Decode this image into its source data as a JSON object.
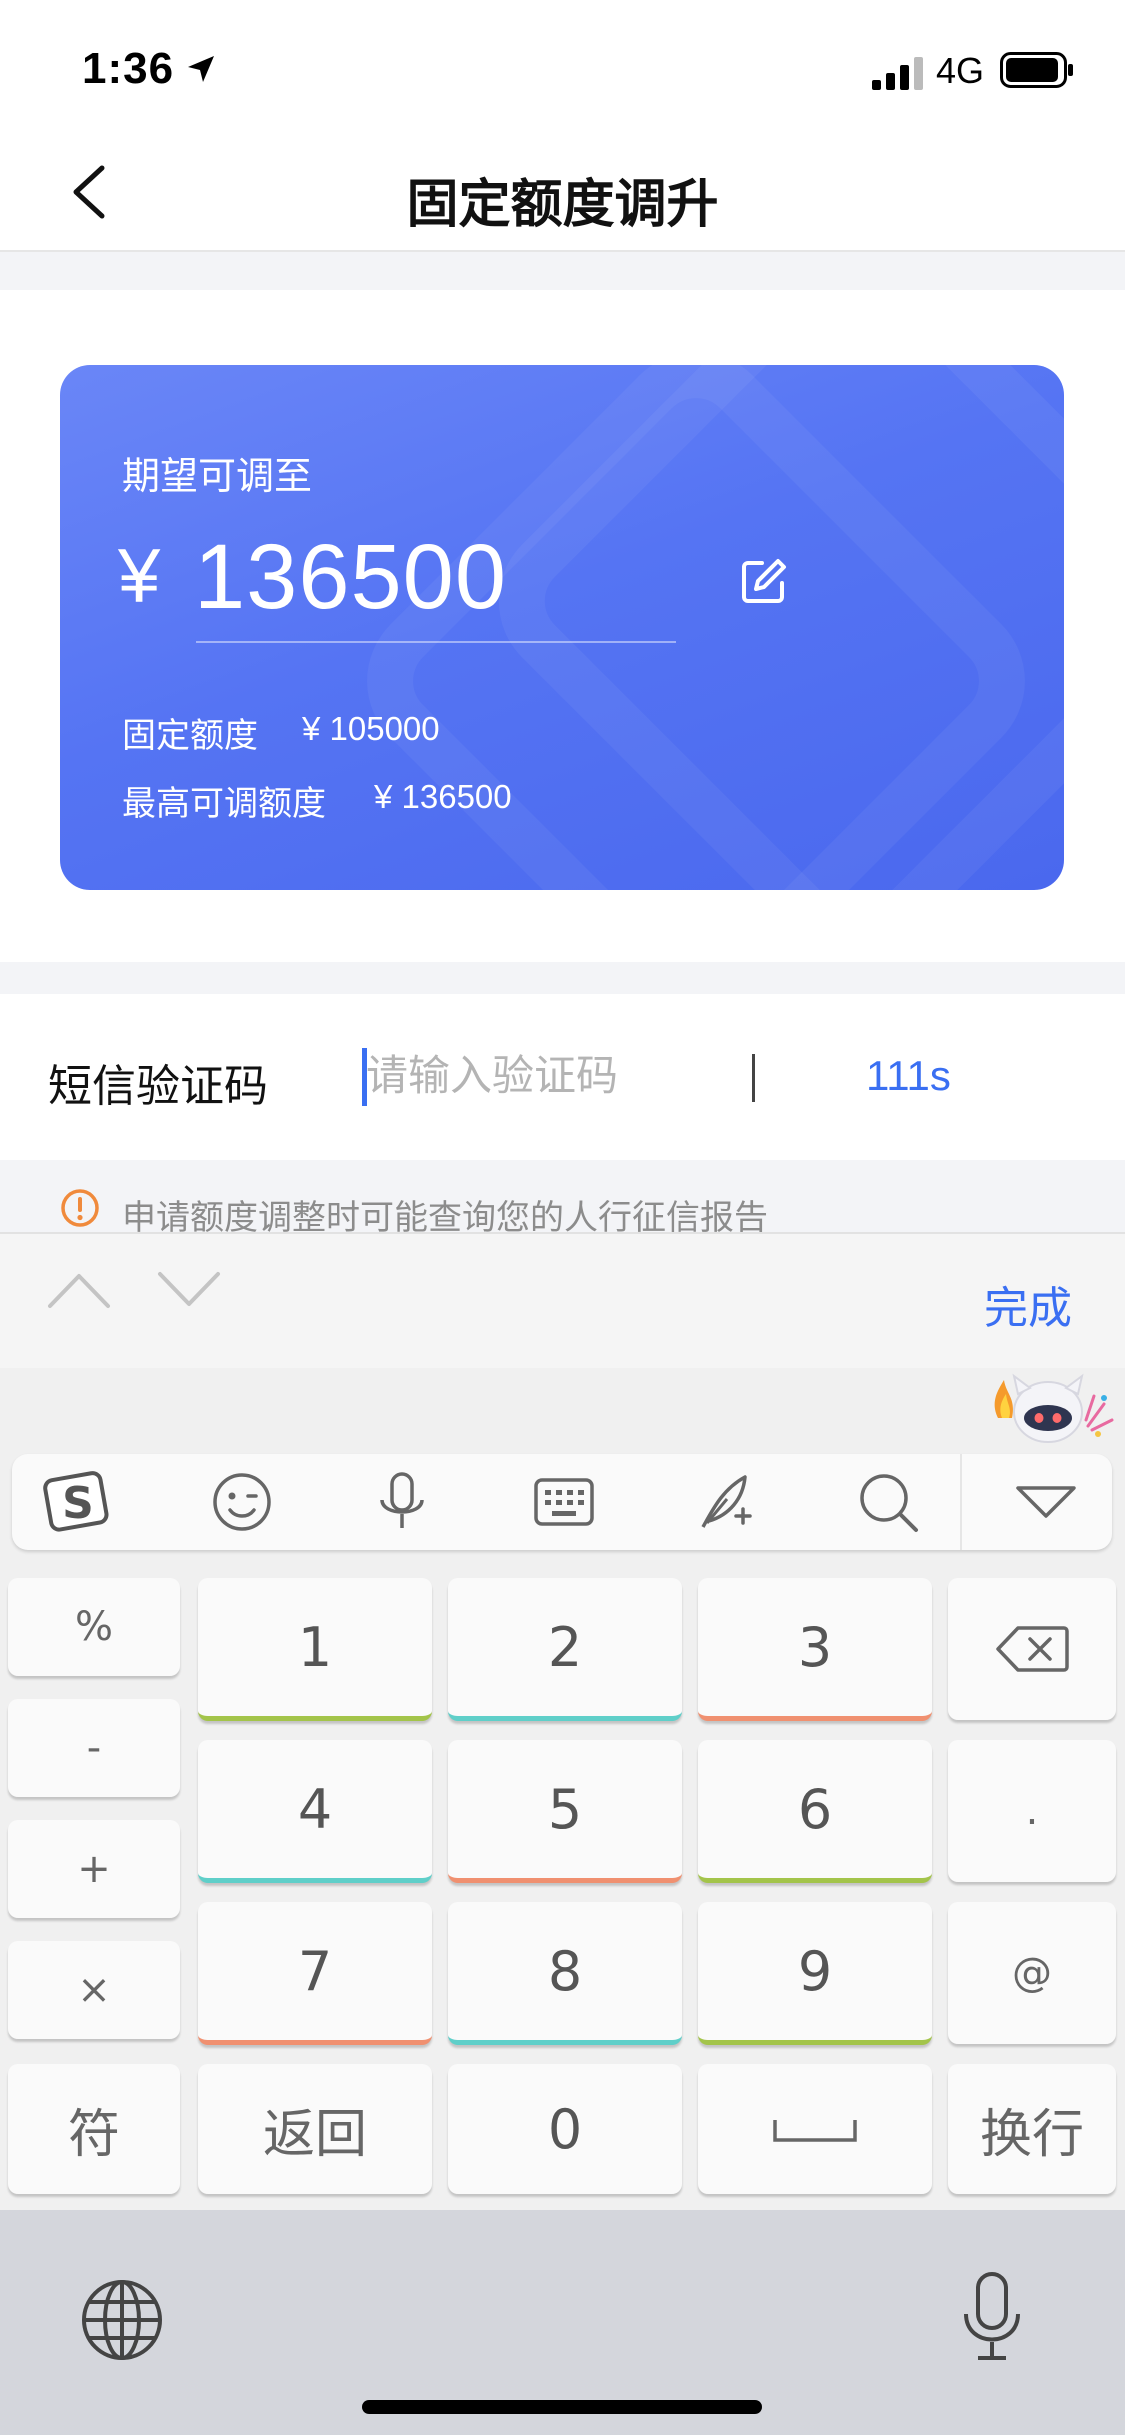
{
  "status_bar": {
    "time": "1:36",
    "network": "4G"
  },
  "nav": {
    "title": "固定额度调升"
  },
  "card": {
    "label": "期望可调至",
    "currency": "¥",
    "amount": "136500",
    "fixed_label": "固定额度",
    "fixed_value": "¥ 105000",
    "max_label": "最高可调额度",
    "max_value": "¥ 136500"
  },
  "sms": {
    "label": "短信验证码",
    "placeholder": "请输入验证码",
    "countdown": "111s"
  },
  "notice": {
    "text": "申请额度调整时可能查询您的人行征信报告"
  },
  "keyboard": {
    "done_label": "完成",
    "side_keys": [
      "%",
      "-",
      "+",
      "×",
      "符"
    ],
    "digits": [
      "1",
      "2",
      "3",
      "4",
      "5",
      "6",
      "7",
      "8",
      "9",
      "0"
    ],
    "dot": ".",
    "at": "@",
    "return_label": "返回",
    "newline_label": "换行"
  },
  "colors": {
    "accent": "#3a6ff2",
    "card_start": "#6a86f7",
    "card_end": "#4a68ee",
    "notice_icon": "#f08a3c"
  }
}
